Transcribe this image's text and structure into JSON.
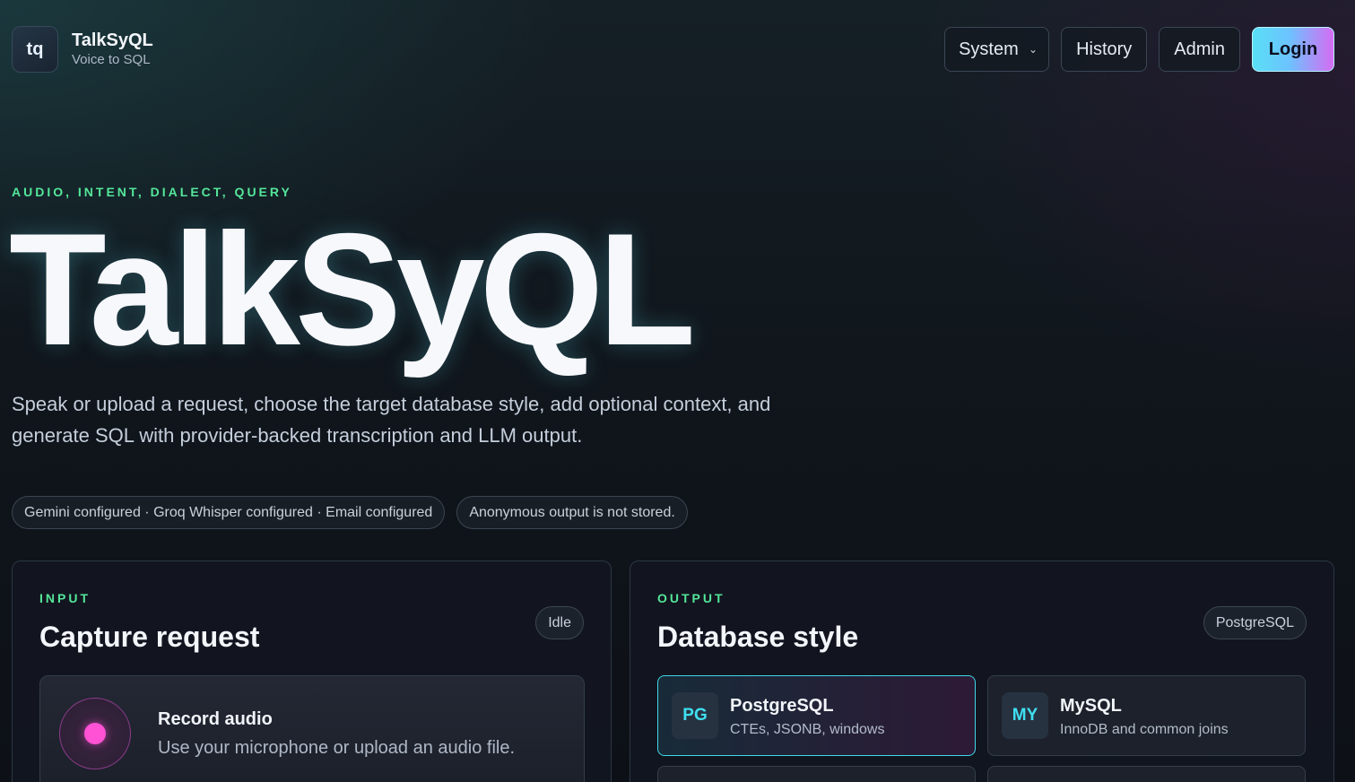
{
  "brand": {
    "logo_text": "tq",
    "name": "TalkSyQL",
    "tagline": "Voice to SQL"
  },
  "nav": {
    "theme_select": "System",
    "history_label": "History",
    "admin_label": "Admin",
    "login_label": "Login"
  },
  "hero": {
    "eyebrow": "AUDIO, INTENT, DIALECT, QUERY",
    "title": "TalkSyQL",
    "description": "Speak or upload a request, choose the target database style, add optional context, and generate SQL with provider-backed transcription and LLM output.",
    "status_pills": [
      "Gemini configured · Groq Whisper configured · Email configured",
      "Anonymous output is not stored."
    ]
  },
  "input_card": {
    "eyebrow": "INPUT",
    "title": "Capture request",
    "status": "Idle",
    "record": {
      "title": "Record audio",
      "subtitle": "Use your microphone or upload an audio file."
    }
  },
  "output_card": {
    "eyebrow": "OUTPUT",
    "title": "Database style",
    "selected": "PostgreSQL",
    "options": [
      {
        "abbr": "PG",
        "name": "PostgreSQL",
        "desc": "CTEs, JSONB, windows"
      },
      {
        "abbr": "MY",
        "name": "MySQL",
        "desc": "InnoDB and common joins"
      }
    ]
  },
  "colors": {
    "accent_green": "#54e69a",
    "accent_cyan": "#3fe0f0",
    "accent_pink": "#ff52d4"
  }
}
